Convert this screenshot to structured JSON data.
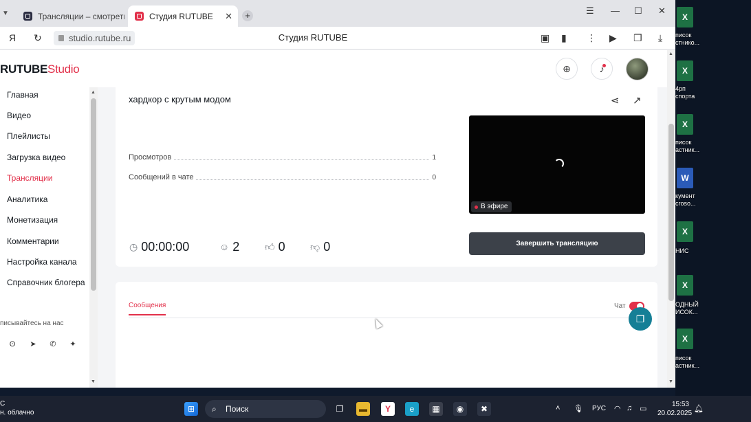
{
  "browser": {
    "tabs": [
      {
        "title": "Трансляции – смотреть в",
        "close": "✕"
      },
      {
        "title": "Студия RUTUBE",
        "close": "✕"
      }
    ],
    "new_tab": "+",
    "window_controls": {
      "menu": "☰",
      "minimize": "—",
      "maximize": "☐",
      "close": "✕"
    },
    "url": "studio.rutube.ru",
    "page_title": "Студия RUTUBE"
  },
  "header": {
    "logo_main": "RUTUBE",
    "logo_sub": "Studio",
    "icons": [
      "upload-icon",
      "bell-icon",
      "avatar"
    ]
  },
  "sidebar": {
    "items": [
      {
        "label": "Главная",
        "active": false
      },
      {
        "label": "Видео",
        "active": false
      },
      {
        "label": "Плейлисты",
        "active": false
      },
      {
        "label": "Загрузка видео",
        "active": false
      },
      {
        "label": "Трансляции",
        "active": true
      },
      {
        "label": "Аналитика",
        "active": false
      },
      {
        "label": "Монетизация",
        "active": false
      },
      {
        "label": "Комментарии",
        "active": false
      },
      {
        "label": "Настройка канала",
        "active": false
      },
      {
        "label": "Справочник блогера",
        "active": false
      }
    ],
    "follow_label": "писывайтесь на нас"
  },
  "stream": {
    "title": "хардкор с крутым модом",
    "stats": [
      {
        "label": "Просмотров",
        "value": "1"
      },
      {
        "label": "Сообщений в чате",
        "value": "0"
      }
    ],
    "timer": "00:00:00",
    "viewers": "2",
    "likes": "0",
    "dislikes": "0",
    "live_badge": "В эфире",
    "end_button": "Завершить трансляцию"
  },
  "chat": {
    "tab_label": "Сообщения",
    "toggle_label": "Чат",
    "toggle_on": true
  },
  "desktop": {
    "icons": [
      {
        "type": "excel",
        "label": "писок\nстнико..."
      },
      {
        "type": "excel",
        "label": "4рп\nспорта"
      },
      {
        "type": "excel",
        "label": "писок\nастник..."
      },
      {
        "type": "word",
        "label": "кумент\ncroso..."
      },
      {
        "type": "excel",
        "label": "НИС"
      },
      {
        "type": "excel",
        "label": "ОДНЫЙ\nИСОК..."
      },
      {
        "type": "excel",
        "label": "писок\nастник..."
      }
    ]
  },
  "taskbar": {
    "weather_line1": "С",
    "weather_line2": "н. облачно",
    "search": "Поиск",
    "lang": "РУС",
    "time": "15:53",
    "date": "20.02.2025"
  },
  "colors": {
    "accent": "#e2304a",
    "dark_button": "#3c4149",
    "support": "#157f96"
  }
}
